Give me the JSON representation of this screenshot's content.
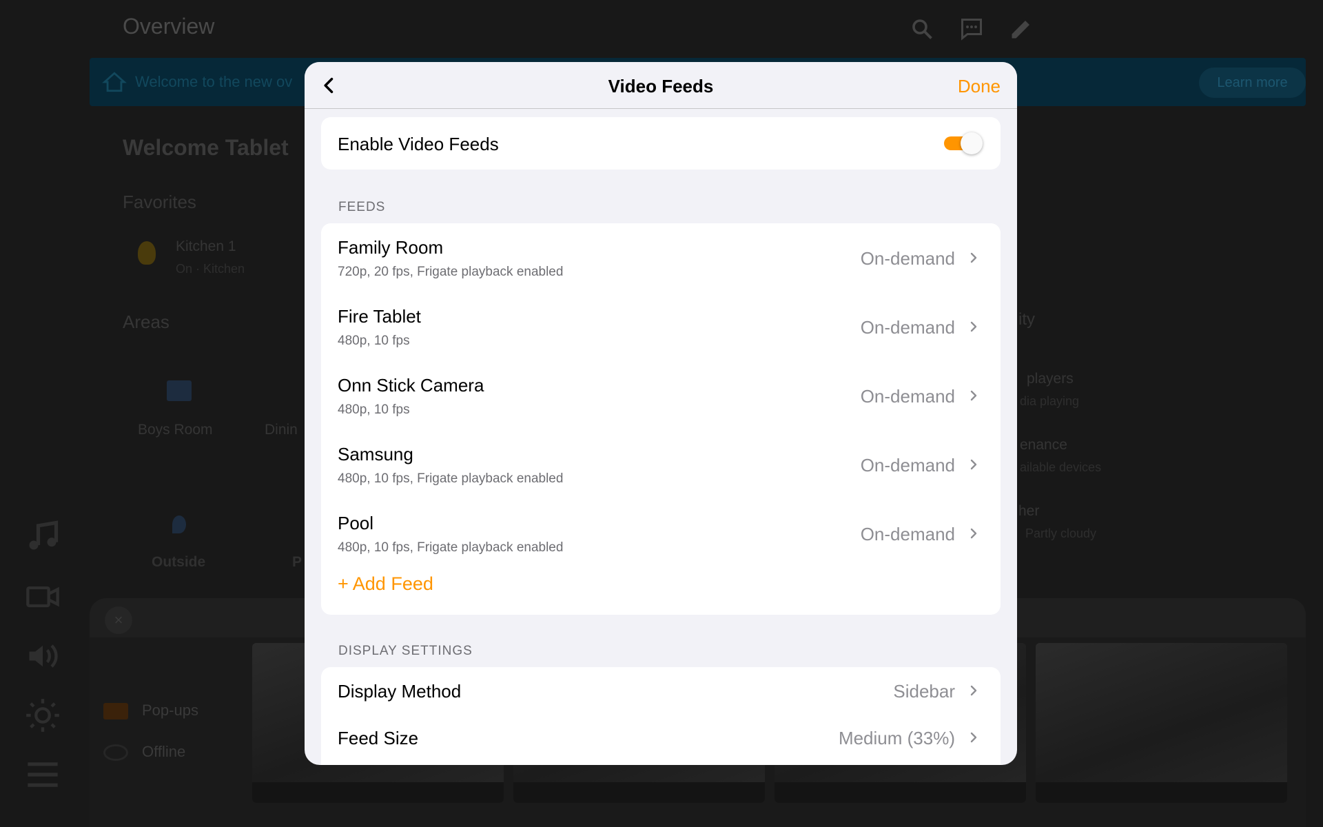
{
  "background": {
    "title": "Overview",
    "banner_text": "Welcome to the new ov",
    "learn_more": "Learn more",
    "heading": "Welcome Tablet",
    "favorites_label": "Favorites",
    "favorite_name": "Kitchen 1",
    "favorite_status": "On · Kitchen",
    "areas_label": "Areas",
    "area_1": "Boys Room",
    "area_2": "Dinin",
    "area_3": "Outside",
    "area_4": "P",
    "right_fragment_1": "ity",
    "right_fragment_2": "players",
    "right_fragment_3": "dia playing",
    "right_fragment_4": "enance",
    "right_fragment_5": "ailable devices",
    "right_fragment_6": "her",
    "right_fragment_7": "Partly cloudy",
    "legend_popups": "Pop-ups",
    "legend_offline": "Offline"
  },
  "modal": {
    "title": "Video Feeds",
    "done_label": "Done",
    "enable_label": "Enable Video Feeds",
    "enabled": true,
    "accent_color": "#ff9500",
    "feeds_header": "FEEDS",
    "feeds": [
      {
        "name": "Family Room",
        "detail": "720p, 20 fps, Frigate playback enabled",
        "mode": "On-demand"
      },
      {
        "name": "Fire Tablet",
        "detail": "480p, 10 fps",
        "mode": "On-demand"
      },
      {
        "name": "Onn Stick Camera",
        "detail": "480p, 10 fps",
        "mode": "On-demand"
      },
      {
        "name": "Samsung",
        "detail": "480p, 10 fps, Frigate playback enabled",
        "mode": "On-demand"
      },
      {
        "name": "Pool",
        "detail": "480p, 10 fps, Frigate playback enabled",
        "mode": "On-demand"
      }
    ],
    "add_feed_label": "+ Add Feed",
    "display_header": "DISPLAY SETTINGS",
    "display_method_label": "Display Method",
    "display_method_value": "Sidebar",
    "feed_size_label": "Feed Size",
    "feed_size_value": "Medium (33%)"
  }
}
